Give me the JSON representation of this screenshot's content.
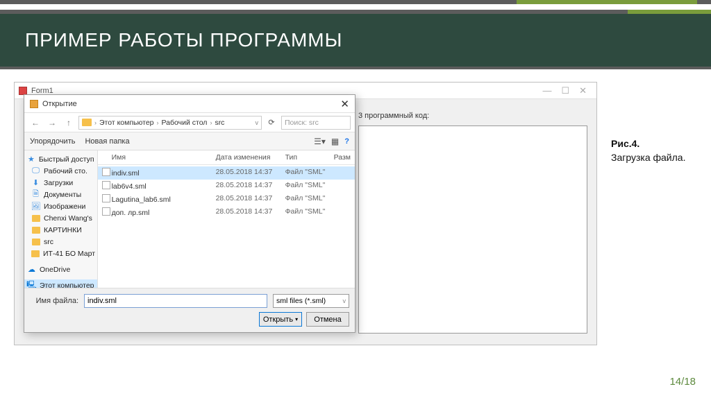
{
  "slide": {
    "title": "ПРИМЕР РАБОТЫ ПРОГРАММЫ",
    "caption_label": "Рис.4.",
    "caption_text": "Загрузка файла.",
    "page": "14/18"
  },
  "form1": {
    "title": "Form1",
    "code_label": "3 программный код:"
  },
  "dialog": {
    "title": "Открытие",
    "breadcrumb": {
      "root": "Этот компьютер",
      "p1": "Рабочий стол",
      "p2": "src"
    },
    "search_placeholder": "Поиск: src",
    "toolbar": {
      "organize": "Упорядочить",
      "newfolder": "Новая папка"
    },
    "sidebar": {
      "quick": "Быстрый доступ",
      "desktop": "Рабочий сто.",
      "downloads": "Загрузки",
      "documents": "Документы",
      "images": "Изображени",
      "chenxi": "Chenxi Wang's",
      "kaptuhku": "КАРТИНКИ",
      "src": "src",
      "it41": "ИТ-41 БО Март",
      "onedrive": "OneDrive",
      "thispc": "Этот компьютер"
    },
    "columns": {
      "name": "Имя",
      "date": "Дата изменения",
      "type": "Тип",
      "size": "Разм"
    },
    "files": [
      {
        "name": "indiv.sml",
        "date": "28.05.2018 14:37",
        "type": "Файл \"SML\"",
        "selected": true
      },
      {
        "name": "lab6v4.sml",
        "date": "28.05.2018 14:37",
        "type": "Файл \"SML\"",
        "selected": false
      },
      {
        "name": "Lagutina_lab6.sml",
        "date": "28.05.2018 14:37",
        "type": "Файл \"SML\"",
        "selected": false
      },
      {
        "name": "доп. лр.sml",
        "date": "28.05.2018 14:37",
        "type": "Файл \"SML\"",
        "selected": false
      }
    ],
    "footer": {
      "filename_label": "Имя файла:",
      "filename_value": "indiv.sml",
      "filter": "sml files (*.sml)",
      "open": "Открыть",
      "cancel": "Отмена"
    }
  }
}
